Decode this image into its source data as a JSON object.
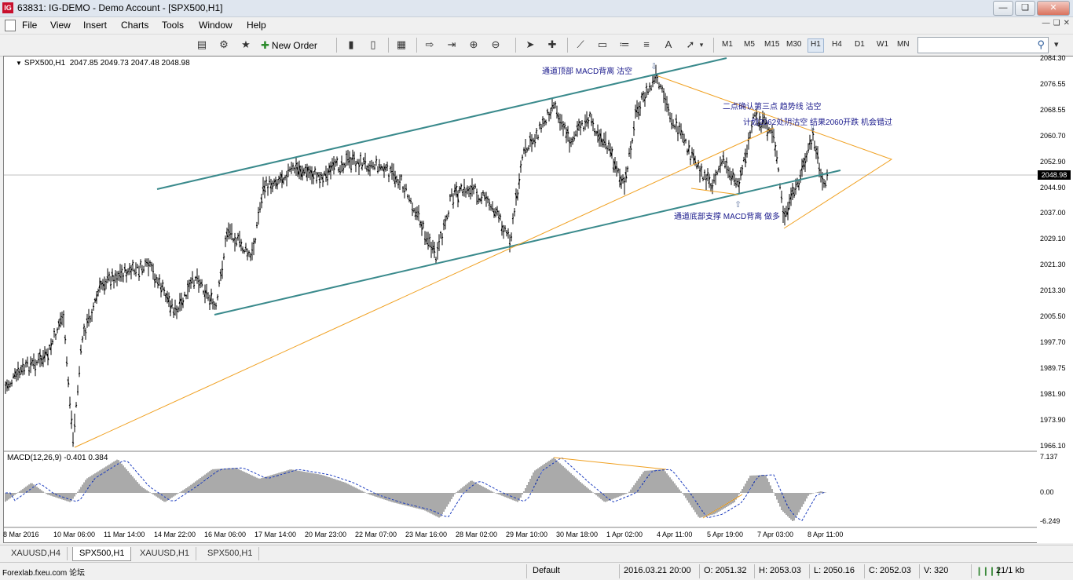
{
  "window": {
    "app_icon_text": "IG",
    "title": "63831: IG-DEMO - Demo Account - [SPX500,H1]"
  },
  "menu": {
    "items": [
      "File",
      "View",
      "Insert",
      "Charts",
      "Tools",
      "Window",
      "Help"
    ]
  },
  "toolbar": {
    "new_order_label": "New Order",
    "timeframes": [
      "M1",
      "M5",
      "M15",
      "M30",
      "H1",
      "H4",
      "D1",
      "W1",
      "MN"
    ],
    "active_timeframe": "H1",
    "search_placeholder": ""
  },
  "chart": {
    "symbol_label": "SPX500,H1",
    "ohlc": "2047.85 2049.73 2047.48 2048.98",
    "current_price": "2048.98",
    "price_ticks": [
      "2084.30",
      "2076.55",
      "2068.55",
      "2060.70",
      "2052.90",
      "2044.90",
      "2037.00",
      "2029.10",
      "2021.30",
      "2013.30",
      "2005.50",
      "1997.70",
      "1989.75",
      "1981.90",
      "1973.90",
      "1966.10"
    ],
    "macd_label": "MACD(12,26,9) -0.401 0.384",
    "macd_ticks": [
      "7.137",
      "0.00",
      "-6.249"
    ],
    "time_ticks": [
      "8 Mar 2016",
      "10 Mar 06:00",
      "11 Mar 14:00",
      "14 Mar 22:00",
      "16 Mar 06:00",
      "17 Mar 14:00",
      "20 Mar 23:00",
      "22 Mar 07:00",
      "23 Mar 16:00",
      "28 Mar 02:00",
      "29 Mar 10:00",
      "30 Mar 18:00",
      "1 Apr 02:00",
      "4 Apr 11:00",
      "5 Apr 19:00",
      "7 Apr 03:00",
      "8 Apr 11:00"
    ],
    "annotations": {
      "top": "通道顶部 MACD背离 沽空",
      "mid1": "二点确认第三点 趋势线 沽空",
      "mid2": "计划2062处阴沽空 结果2060开跌 机会错过",
      "bottom": "通道底部支撑 MACD背离 做多"
    },
    "colors": {
      "candle": "#000000",
      "channel": "#3a8a8c",
      "trendline": "#f0a020",
      "macd_bar": "#555555"
    }
  },
  "tabs": [
    "XAUUSD,H4",
    "SPX500,H1",
    "XAUUSD,H1",
    "SPX500,H1"
  ],
  "active_tab": 1,
  "status": {
    "watermark": "Forexlab.fxeu.com 论坛",
    "profile": "Default",
    "datetime": "2016.03.21 20:00",
    "open": "O: 2051.32",
    "high": "H: 2053.03",
    "low": "L: 2050.16",
    "close": "C: 2052.03",
    "volume": "V: 320",
    "traffic": "21/1 kb"
  }
}
